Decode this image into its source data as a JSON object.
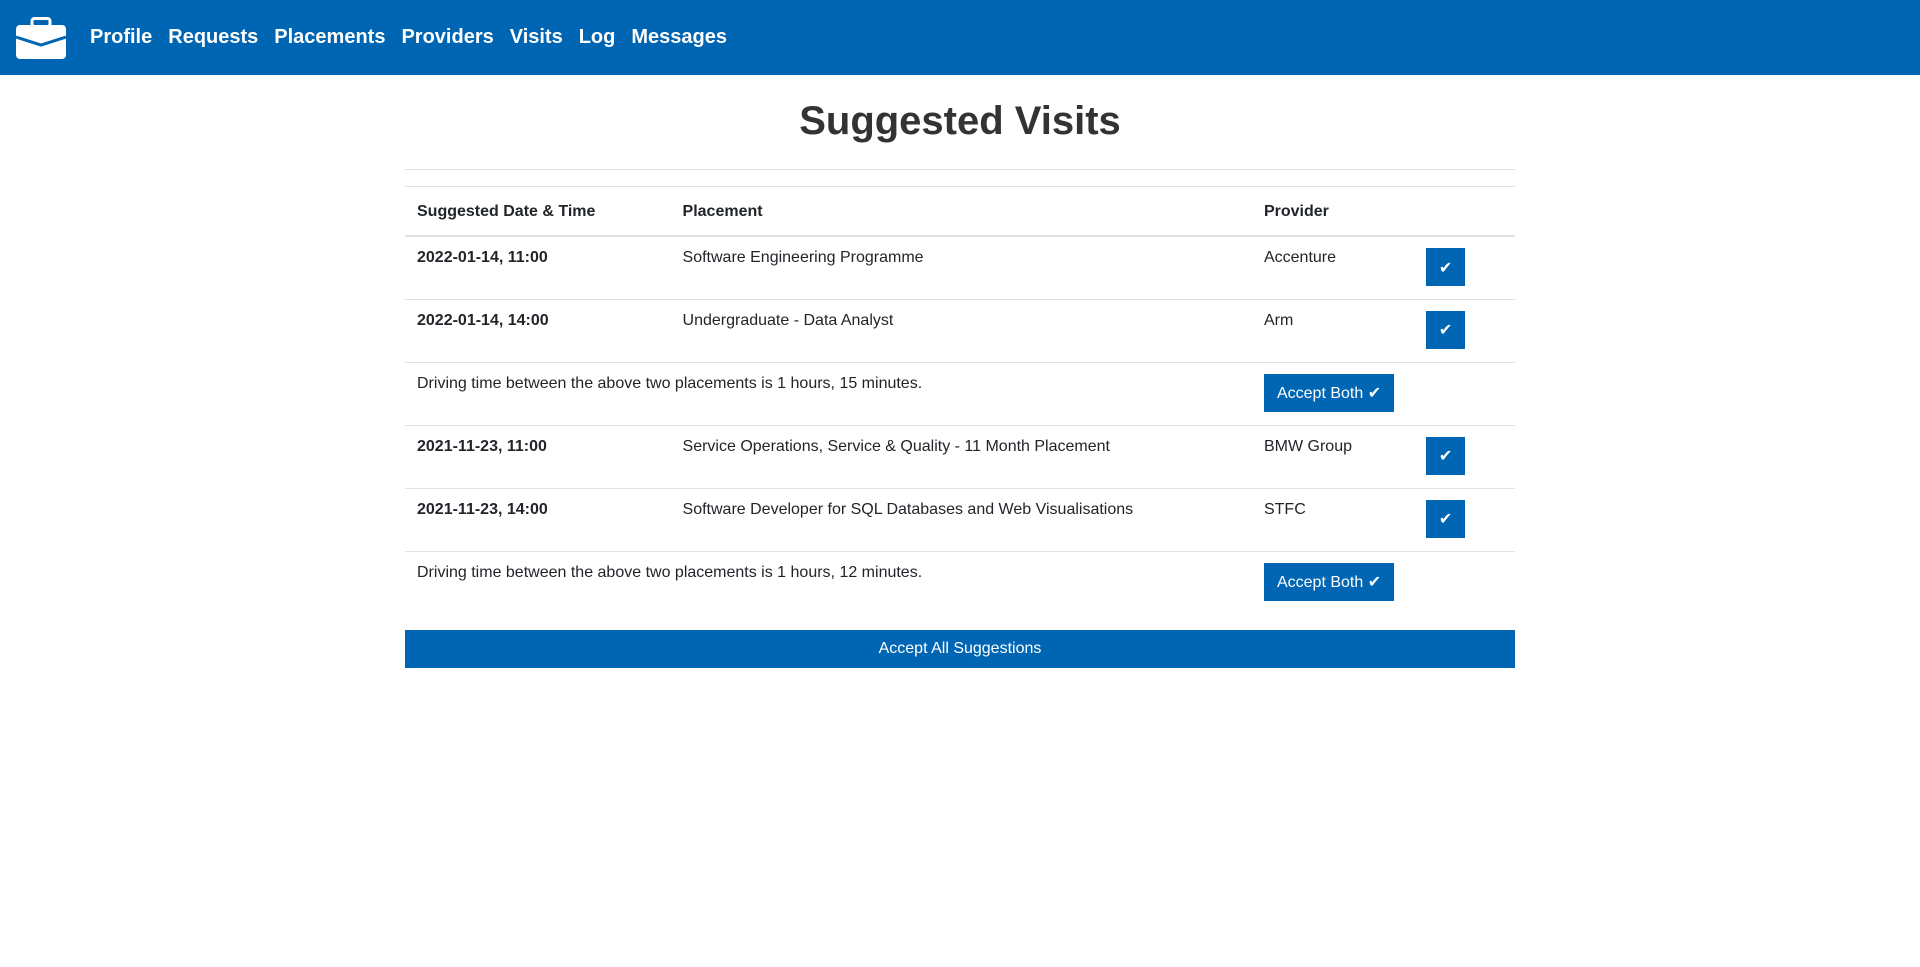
{
  "nav": {
    "logo_icon": "briefcase-icon",
    "links": [
      "Profile",
      "Requests",
      "Placements",
      "Providers",
      "Visits",
      "Log",
      "Messages"
    ]
  },
  "page": {
    "title": "Suggested Visits"
  },
  "table": {
    "headers": {
      "date": "Suggested Date & Time",
      "placement": "Placement",
      "provider": "Provider"
    },
    "groups": [
      {
        "visits": [
          {
            "datetime": "2022-01-14, 11:00",
            "placement": "Software Engineering Programme",
            "provider": "Accenture",
            "accept_label": "✔"
          },
          {
            "datetime": "2022-01-14, 14:00",
            "placement": "Undergraduate - Data Analyst",
            "provider": "Arm",
            "accept_label": "✔"
          }
        ],
        "driving_note": "Driving time between the above two placements is 1 hours, 15 minutes.",
        "accept_both_label": "Accept Both ✔"
      },
      {
        "visits": [
          {
            "datetime": "2021-11-23, 11:00",
            "placement": "Service Operations, Service & Quality - 11 Month Placement",
            "provider": "BMW Group",
            "accept_label": "✔"
          },
          {
            "datetime": "2021-11-23, 14:00",
            "placement": "Software Developer for SQL Databases and Web Visualisations",
            "provider": "STFC",
            "accept_label": "✔"
          }
        ],
        "driving_note": "Driving time between the above two placements is 1 hours, 12 minutes.",
        "accept_both_label": "Accept Both ✔"
      }
    ]
  },
  "accept_all_label": "Accept All Suggestions",
  "colors": {
    "primary": "#0065b3",
    "title": "#333333",
    "border": "#dee2e6"
  }
}
